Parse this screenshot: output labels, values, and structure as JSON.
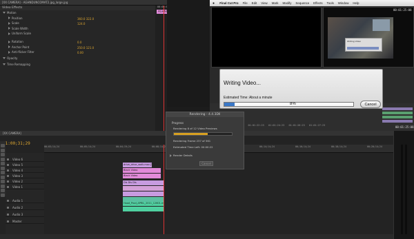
{
  "effect_controls": {
    "tab_label": "[XX CAMERA] - AGHNDUNCOMAT2.jpg_large.jpg",
    "section": "Video Effects",
    "clip_label": "AGHNDUNCOMAT2.jpg_large.jpg",
    "timecode_top": "00:00:00:00",
    "rows": [
      {
        "label": "Motion",
        "value": "",
        "kind": "group"
      },
      {
        "label": "Position",
        "value": "360.0  322.0",
        "kind": "param"
      },
      {
        "label": "Scale",
        "value": "124.0",
        "kind": "param"
      },
      {
        "label": "Scale Width",
        "value": "",
        "kind": "param"
      },
      {
        "label": "Uniform Scale",
        "value": "",
        "kind": "check"
      },
      {
        "label": "Rotation",
        "value": "0.0",
        "kind": "param"
      },
      {
        "label": "Anchor Point",
        "value": "250.0  121.0",
        "kind": "param"
      },
      {
        "label": "Anti-flicker Filter",
        "value": "0.00",
        "kind": "param"
      },
      {
        "label": "Opacity",
        "value": "",
        "kind": "group"
      },
      {
        "label": "Time Remapping",
        "value": "",
        "kind": "group"
      }
    ]
  },
  "fcp": {
    "app_name": "Final Cut Pro",
    "menu": [
      "Final Cut Pro",
      "File",
      "Edit",
      "View",
      "Mark",
      "Modify",
      "Sequence",
      "Effects",
      "Tools",
      "Window",
      "Help"
    ],
    "canvas_timecode": "00:01:25:08",
    "canvas_dialog_title": "Writing Video"
  },
  "writing_dialog": {
    "title": "Writing Video...",
    "estimate": "Estimated Time: About a minute",
    "percent_label": "8%",
    "progress": 0.08,
    "cancel_label": "Cancel"
  },
  "rendering_dialog": {
    "title": "Rendering - 4.4.3Dll",
    "progress_heading": "Progress",
    "line1": "Rendering 8 of 12 Video Previews",
    "progress": 0.58,
    "line2": "Rendering Frame 237 of 561",
    "line3": "Estimated Time Left: 00:00:22",
    "details": "Render Details",
    "cancel_label": "Cancel"
  },
  "timeline": {
    "tab_label": "[XX CAMERA]",
    "timecode": "01:00;31;29",
    "ruler": [
      "00;03;14;24",
      "00;05;14;24",
      "00;04;19;24",
      "00;08;14;24",
      "00;10;14;24",
      "00;12;14;24",
      "00;14;14;24",
      "00;16;14;24",
      "00;18;14;24",
      "00;20;14;24"
    ],
    "tracks": [
      "Video 6",
      "Video 5",
      "Video 4",
      "Video 3",
      "Video 2",
      "Video 1",
      "Audio 1",
      "Audio 2",
      "Audio 3",
      "Master"
    ],
    "clips": [
      {
        "label": "drive_drive_walk.mov [V] [X]",
        "color": "#c79be0"
      },
      {
        "label": "Black Video",
        "color": "#e28ad9"
      },
      {
        "label": "Black Video",
        "color": "#e28ad9"
      },
      {
        "label": "Dis Dis Dis",
        "color": "#c79be0"
      },
      {
        "label": "Hood_Prod_APRIL_2011_12601.mp3",
        "color": "#4fd0a0"
      }
    ]
  },
  "colors": {
    "accent_value": "#e0a830",
    "playhead": "#dd3333",
    "progress_blue": "#3a78c8",
    "progress_gold": "#d8a020"
  }
}
